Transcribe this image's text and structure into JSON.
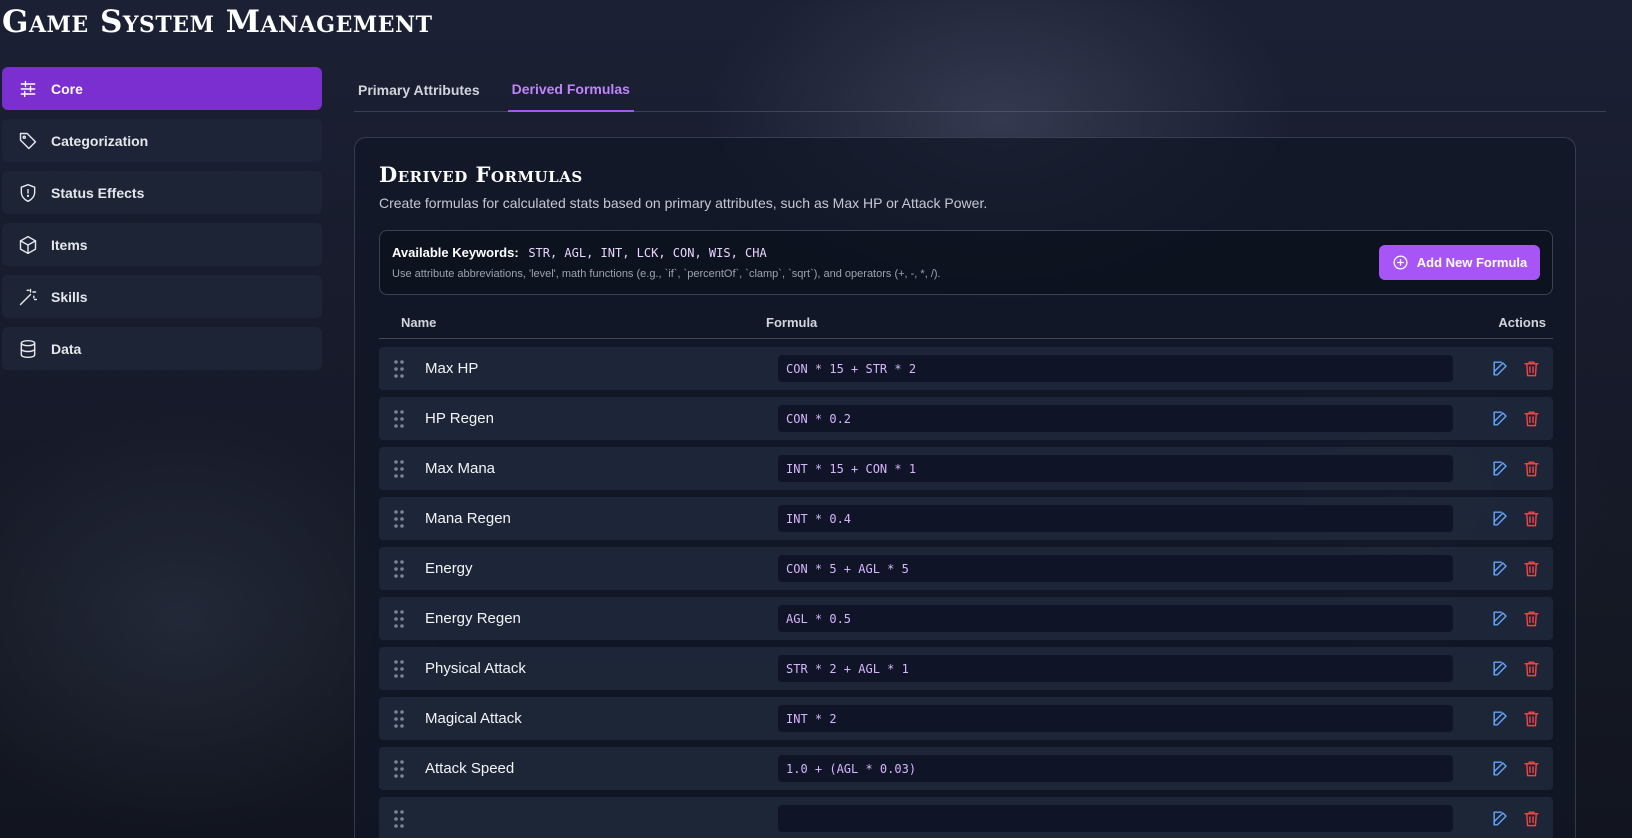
{
  "app": {
    "title": "Game System Management"
  },
  "sidebar": {
    "items": [
      {
        "label": "Core",
        "icon": "sliders-icon",
        "active": true
      },
      {
        "label": "Categorization",
        "icon": "tag-icon",
        "active": false
      },
      {
        "label": "Status Effects",
        "icon": "shield-alert-icon",
        "active": false
      },
      {
        "label": "Items",
        "icon": "box-icon",
        "active": false
      },
      {
        "label": "Skills",
        "icon": "magic-wand-icon",
        "active": false
      },
      {
        "label": "Data",
        "icon": "database-icon",
        "active": false
      }
    ]
  },
  "tabs": [
    {
      "label": "Primary Attributes",
      "active": false
    },
    {
      "label": "Derived Formulas",
      "active": true
    }
  ],
  "panel": {
    "title": "Derived Formulas",
    "description": "Create formulas for calculated stats based on primary attributes, such as Max HP or Attack Power.",
    "keywords_label": "Available Keywords:",
    "keywords": "STR, AGL, INT, LCK, CON, WIS, CHA",
    "keywords_help": "Use attribute abbreviations, 'level', math functions (e.g., `if`, `percentOf`, `clamp`, `sqrt`), and operators (+, -, *, /).",
    "add_button": "Add New Formula"
  },
  "table": {
    "headers": {
      "name": "Name",
      "formula": "Formula",
      "actions": "Actions"
    },
    "rows": [
      {
        "name": "Max HP",
        "formula": "CON * 15 + STR * 2"
      },
      {
        "name": "HP Regen",
        "formula": "CON * 0.2"
      },
      {
        "name": "Max Mana",
        "formula": "INT * 15 + CON * 1"
      },
      {
        "name": "Mana Regen",
        "formula": "INT * 0.4"
      },
      {
        "name": "Energy",
        "formula": "CON * 5 + AGL * 5"
      },
      {
        "name": "Energy Regen",
        "formula": "AGL * 0.5"
      },
      {
        "name": "Physical Attack",
        "formula": "STR * 2 + AGL * 1"
      },
      {
        "name": "Magical Attack",
        "formula": "INT * 2"
      },
      {
        "name": "Attack Speed",
        "formula": "1.0 + (AGL * 0.03)"
      },
      {
        "name": "",
        "formula": ""
      }
    ]
  },
  "colors": {
    "accent": "#a855f7",
    "sidebar_active": "#7c2fd0",
    "edit": "#60a5fa",
    "delete": "#ef4444"
  }
}
